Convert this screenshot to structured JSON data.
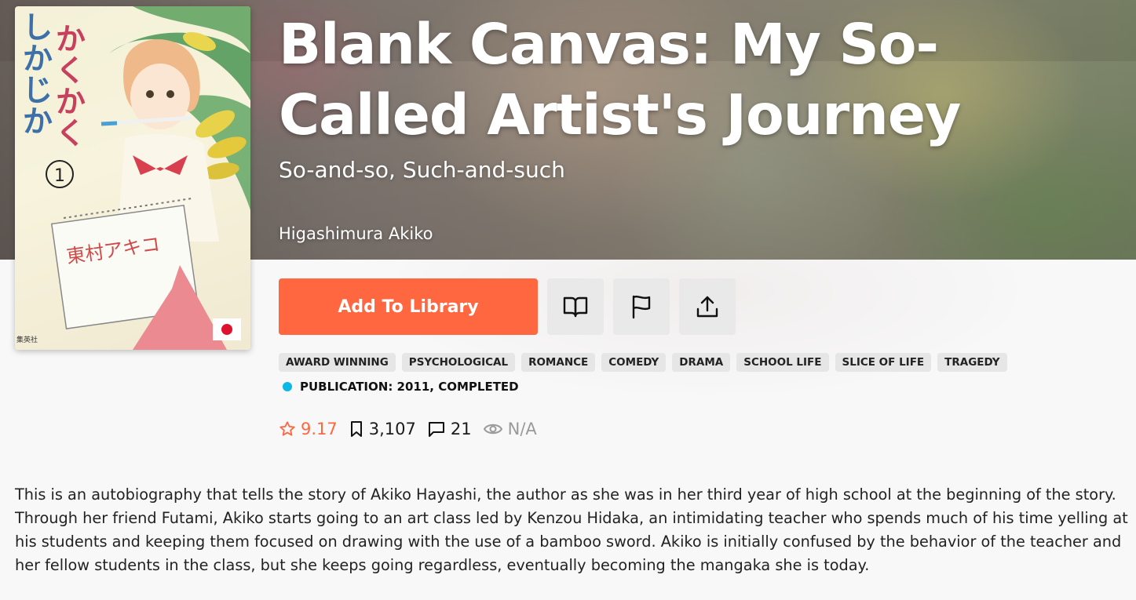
{
  "manga": {
    "title": "Blank Canvas: My So-Called Artist's Journey",
    "alt_title": "So-and-so, Such-and-such",
    "author": "Higashimura Akiko",
    "cover": {
      "japanese_title": "かくかくしかじか",
      "volume": "1",
      "author_jp": "東村アキコ",
      "publisher_jp": "集英社"
    }
  },
  "actions": {
    "add_to_library": "Add To Library",
    "read_icon": "open-book-icon",
    "report_icon": "flag-icon",
    "share_icon": "share-upload-icon"
  },
  "tags": [
    "AWARD WINNING",
    "PSYCHOLOGICAL",
    "ROMANCE",
    "COMEDY",
    "DRAMA",
    "SCHOOL LIFE",
    "SLICE OF LIFE",
    "TRAGEDY"
  ],
  "publication": {
    "text": "PUBLICATION: 2011, COMPLETED",
    "status_color": "#0ab7e6"
  },
  "stats": {
    "rating": "9.17",
    "follows": "3,107",
    "comments": "21",
    "views": "N/A"
  },
  "description": "This is an autobiography that tells the story of Akiko Hayashi, the author as she was in her third year of high school at the beginning of the story. Through her friend Futami, Akiko starts going to an art class led by Kenzou Hidaka, an intimidating teacher who spends much of his time yelling at his students and keeping them focused on drawing with the use of a bamboo sword. Akiko is initially confused by the behavior of the teacher and her fellow students in the class, but she keeps going regardless, eventually becoming the mangaka she is today.",
  "colors": {
    "accent": "#ff6740",
    "icon_button_bg": "#e9e9ea"
  }
}
